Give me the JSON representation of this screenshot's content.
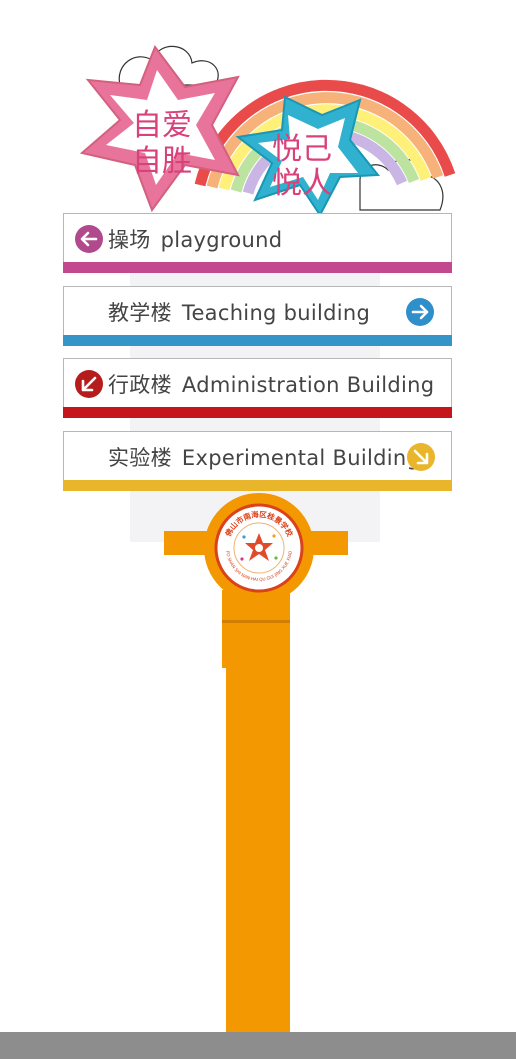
{
  "motto_left": {
    "line1": "自爱",
    "line2": "自胜"
  },
  "motto_right": {
    "line1": "悦己",
    "line2": "悦人"
  },
  "signs": [
    {
      "zh": "操场",
      "en": "playground",
      "bar_color": "#c2498f",
      "arrow": "left",
      "arrow_color": "#b04a8c"
    },
    {
      "zh": "教学楼",
      "en": "Teaching building",
      "bar_color": "#3595c9",
      "arrow": "right",
      "arrow_color": "#2f8fca"
    },
    {
      "zh": "行政楼",
      "en": "Administration Building",
      "bar_color": "#c4161c",
      "arrow": "down-left",
      "arrow_color": "#b51d1d"
    },
    {
      "zh": "实验楼",
      "en": "Experimental Building",
      "bar_color": "#e8b52b",
      "arrow": "down-right",
      "arrow_color": "#e8b52b"
    }
  ],
  "post_color": "#f39800",
  "school_logo": {
    "top_text": "佛山市南海区桂景学校",
    "bottom_text": "FO SHAN SHI NAN HAI QU GUI JING XUE XIAO"
  }
}
